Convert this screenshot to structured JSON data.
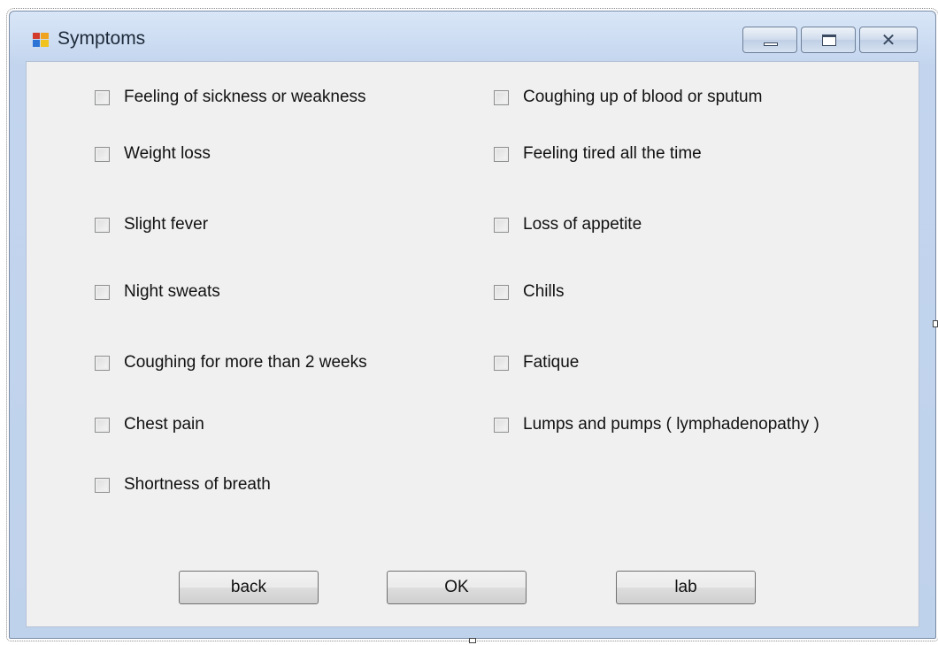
{
  "window": {
    "title": "Symptoms",
    "minimize_glyph": "",
    "maximize_glyph": "",
    "close_glyph": "✕"
  },
  "symptoms": {
    "left": [
      {
        "label": "Feeling of sickness or weakness",
        "checked": false
      },
      {
        "label": "Weight loss",
        "checked": false
      },
      {
        "label": "Slight fever",
        "checked": false
      },
      {
        "label": "Night sweats",
        "checked": false
      },
      {
        "label": "Coughing for more than 2 weeks",
        "checked": false
      },
      {
        "label": "Chest pain",
        "checked": false
      },
      {
        "label": "Shortness of breath",
        "checked": false
      }
    ],
    "right": [
      {
        "label": "Coughing up of blood or sputum",
        "checked": false
      },
      {
        "label": "Feeling tired all the time",
        "checked": false
      },
      {
        "label": "Loss of appetite",
        "checked": false
      },
      {
        "label": "Chills",
        "checked": false
      },
      {
        "label": "Fatique",
        "checked": false
      },
      {
        "label": "Lumps and pumps ( lymphadenopathy )",
        "checked": false
      }
    ]
  },
  "buttons": {
    "back": "back",
    "ok": "OK",
    "lab": "lab"
  }
}
